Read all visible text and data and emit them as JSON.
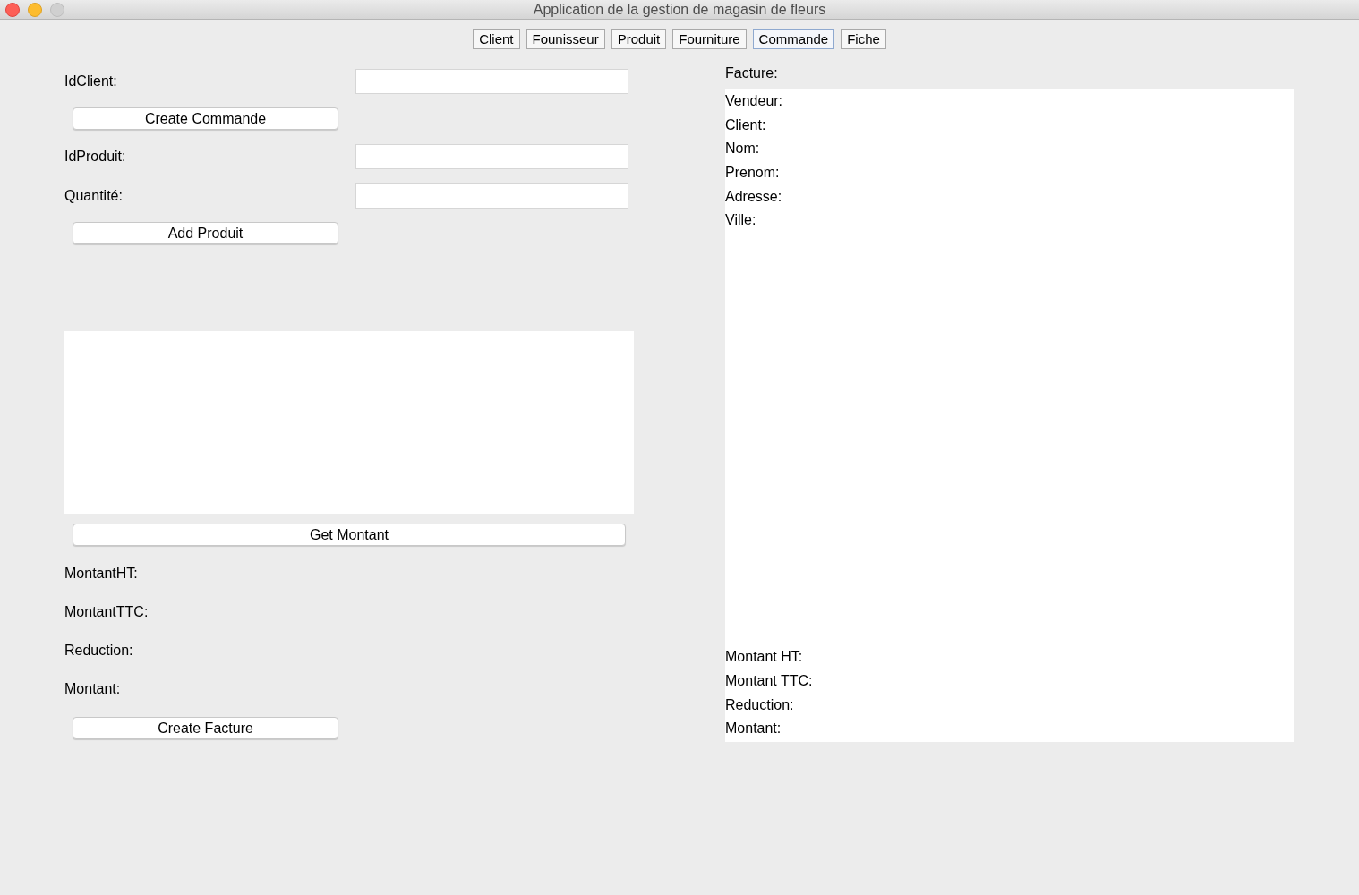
{
  "window": {
    "title": "Application de la gestion de magasin de fleurs"
  },
  "tabs": [
    {
      "label": "Client",
      "selected": false
    },
    {
      "label": "Founisseur",
      "selected": false
    },
    {
      "label": "Produit",
      "selected": false
    },
    {
      "label": "Fourniture",
      "selected": false
    },
    {
      "label": "Commande",
      "selected": true
    },
    {
      "label": "Fiche",
      "selected": false
    }
  ],
  "commande_form": [
    {
      "kind": "field",
      "label": "IdClient:"
    },
    {
      "kind": "button",
      "label": "Create Commande"
    },
    {
      "kind": "field",
      "label": "IdProduit:"
    },
    {
      "kind": "field",
      "label": "Quantité:"
    },
    {
      "kind": "button",
      "label": "Add Produit"
    },
    {
      "kind": "list"
    },
    {
      "kind": "wide_button",
      "label": "Get Montant"
    },
    {
      "kind": "label",
      "label": "MontantHT:"
    },
    {
      "kind": "label",
      "label": "MontantTTC:"
    },
    {
      "kind": "label",
      "label": "Reduction:"
    },
    {
      "kind": "label",
      "label": "Montant:"
    },
    {
      "kind": "button",
      "label": "Create Facture"
    }
  ],
  "facture": {
    "title": "Facture:",
    "header_lines": [
      "Vendeur:",
      "Client:",
      "Nom:",
      "Prenom:",
      "Adresse:",
      "Ville:"
    ],
    "total_lines": [
      "Montant HT:",
      "Montant TTC:",
      "Reduction:",
      "Montant:"
    ]
  }
}
